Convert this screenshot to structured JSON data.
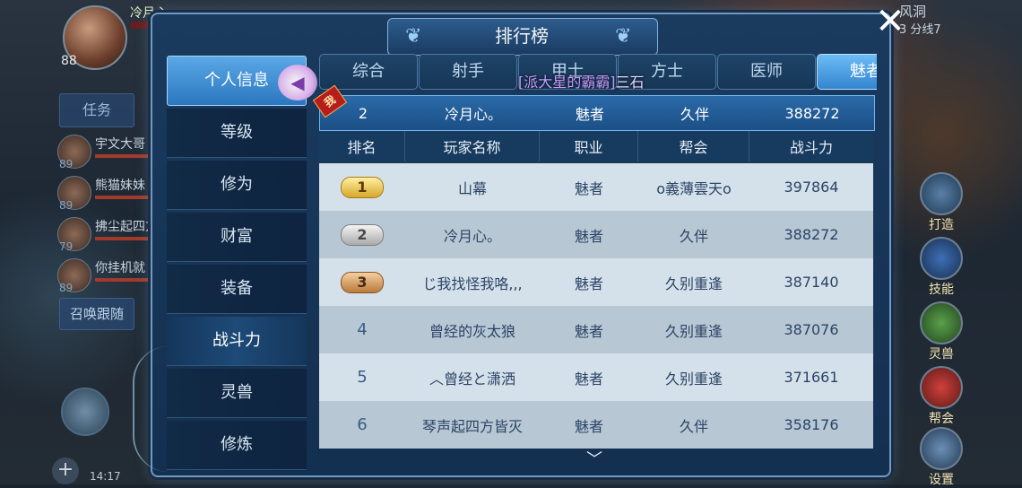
{
  "hud": {
    "player_level": "88",
    "player_name": "冷月心。",
    "task_tab": "任务",
    "team": [
      {
        "name": "宇文大哥",
        "level": "89"
      },
      {
        "name": "熊猫妹妹",
        "level": "89"
      },
      {
        "name": "拂尘起四方",
        "level": "79"
      },
      {
        "name": "你挂机就",
        "level": "89"
      }
    ],
    "summon_button": "召唤跟随",
    "clock": "14:17",
    "zone": "风洞",
    "zone_line": "3 分线7"
  },
  "skills": [
    {
      "label": "打造",
      "icon": "hammer-icon"
    },
    {
      "label": "技能",
      "icon": "book-icon"
    },
    {
      "label": "灵兽",
      "icon": "beast-icon"
    },
    {
      "label": "帮会",
      "icon": "scroll-icon"
    },
    {
      "label": "设置",
      "icon": "gear-icon"
    }
  ],
  "panel": {
    "title": "排行榜",
    "close": "✕"
  },
  "menu": [
    {
      "label": "个人信息"
    },
    {
      "label": "等级"
    },
    {
      "label": "修为"
    },
    {
      "label": "财富"
    },
    {
      "label": "装备"
    },
    {
      "label": "战斗力"
    },
    {
      "label": "灵兽"
    },
    {
      "label": "修炼"
    }
  ],
  "tabs": [
    "综合",
    "射手",
    "甲士",
    "方士",
    "医师",
    "魅者"
  ],
  "broadcast": {
    "channel": "[派大星的霸霸]",
    "text": "三石"
  },
  "my_rank": {
    "badge": "我",
    "rank": "2",
    "name": "冷月心。",
    "job": "魅者",
    "guild": "久伴",
    "power": "388272"
  },
  "table": {
    "headers": {
      "rank": "排名",
      "name": "玩家名称",
      "job": "职业",
      "guild": "帮会",
      "power": "战斗力"
    },
    "rows": [
      {
        "rank": "1",
        "name": "山幕",
        "job": "魅者",
        "guild": "o義薄雲天o",
        "power": "397864"
      },
      {
        "rank": "2",
        "name": "冷月心。",
        "job": "魅者",
        "guild": "久伴",
        "power": "388272"
      },
      {
        "rank": "3",
        "name": "じ我找怪我咯,,,",
        "job": "魅者",
        "guild": "久别重逢",
        "power": "387140"
      },
      {
        "rank": "4",
        "name": "曾经的灰太狼",
        "job": "魅者",
        "guild": "久别重逢",
        "power": "387076"
      },
      {
        "rank": "5",
        "name": "︿曾经と潇洒",
        "job": "魅者",
        "guild": "久别重逢",
        "power": "371661"
      },
      {
        "rank": "6",
        "name": "琴声起四方皆灭",
        "job": "魅者",
        "guild": "久伴",
        "power": "358176"
      }
    ]
  },
  "colors": {
    "panel_bg": "#1a3a5e",
    "tab_active": "#3385cf",
    "row_light": "#d5e1ea",
    "row_dark": "#b7c7d4"
  }
}
